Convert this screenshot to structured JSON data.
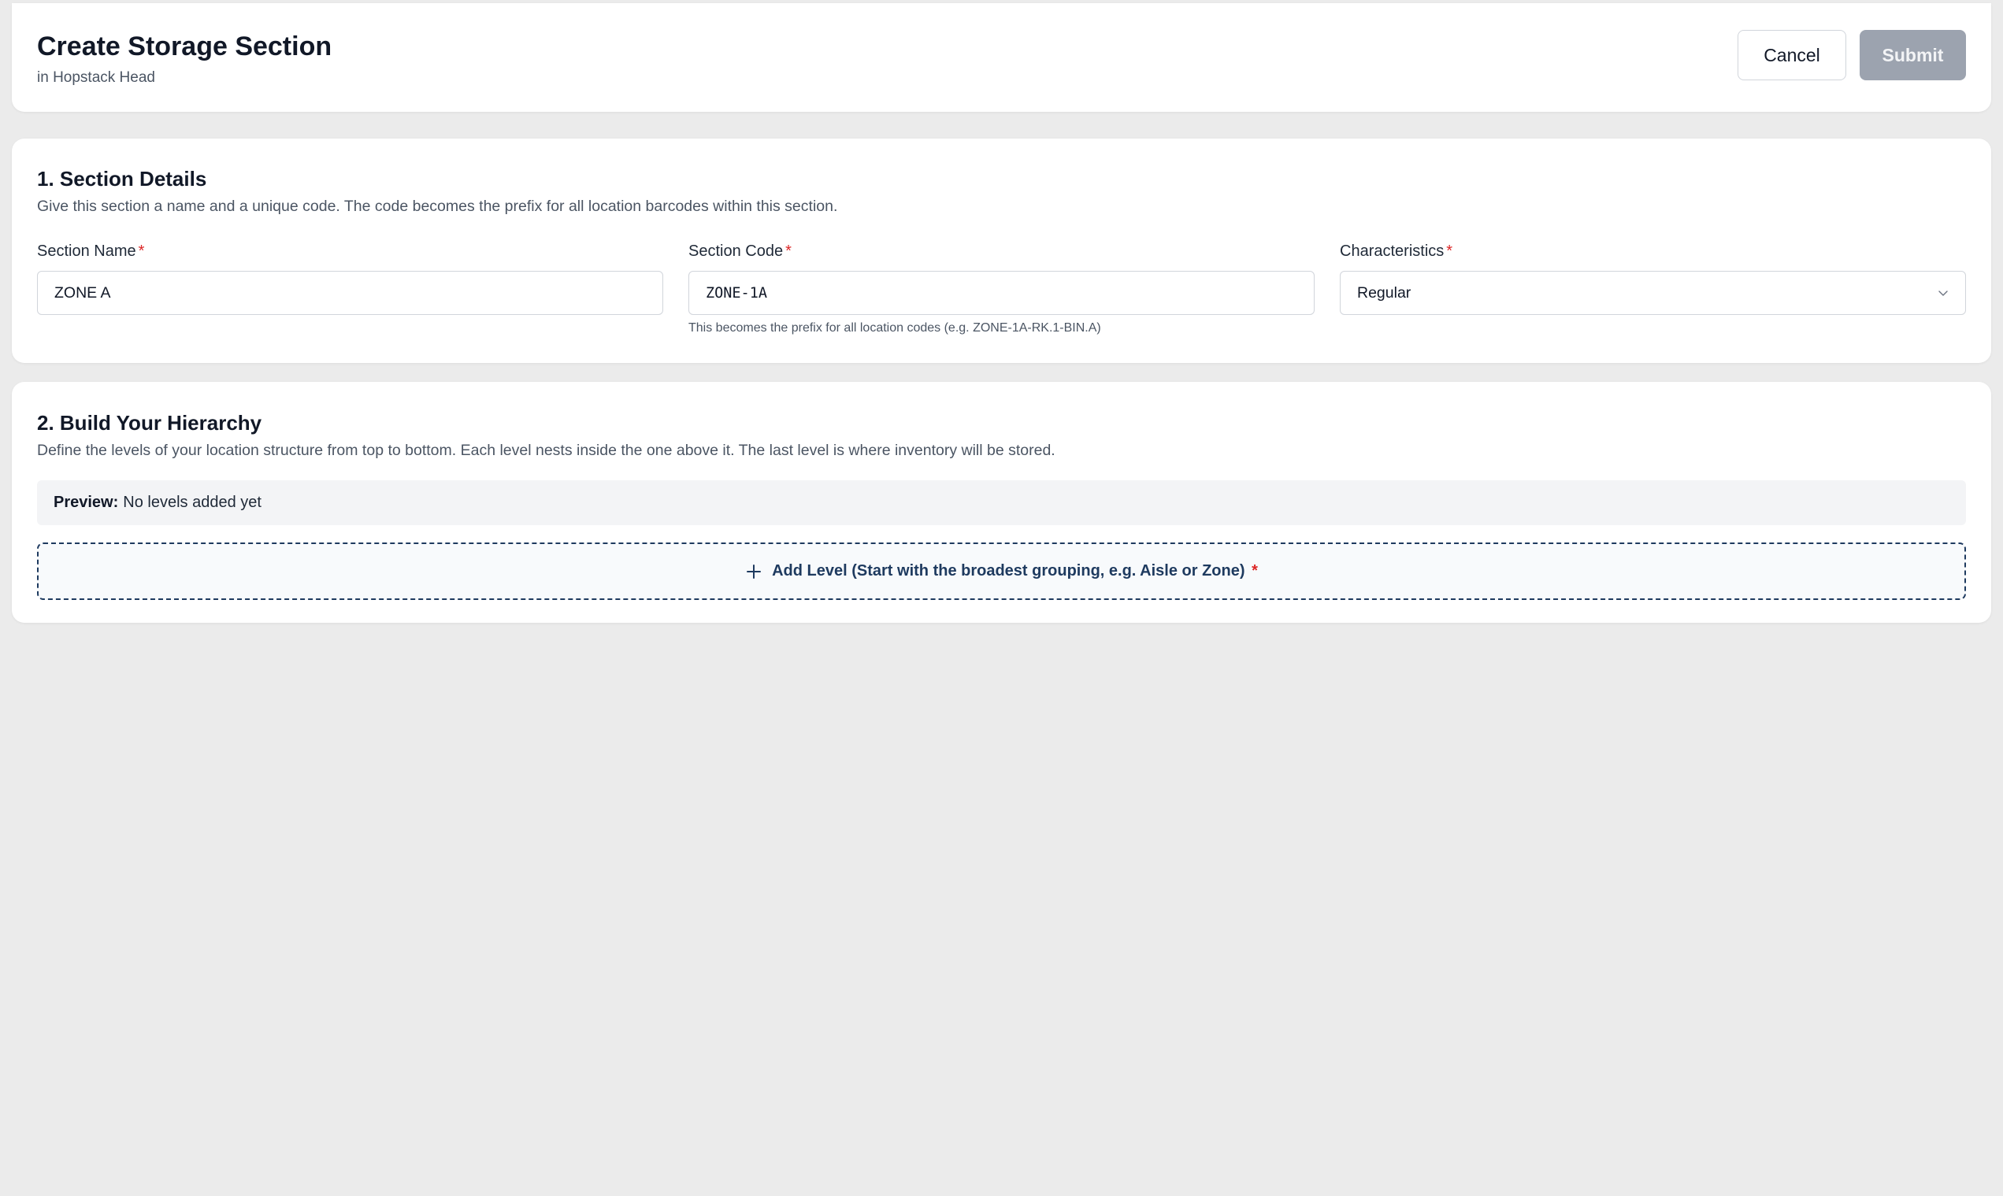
{
  "header": {
    "title": "Create Storage Section",
    "subtitle": "in Hopstack Head",
    "cancel_label": "Cancel",
    "submit_label": "Submit"
  },
  "section_details": {
    "title": "1. Section Details",
    "description": "Give this section a name and a unique code. The code becomes the prefix for all location barcodes within this section.",
    "fields": {
      "section_name": {
        "label": "Section Name",
        "required_mark": "*",
        "value": "ZONE A"
      },
      "section_code": {
        "label": "Section Code",
        "required_mark": "*",
        "value": "ZONE-1A",
        "hint": "This becomes the prefix for all location codes (e.g. ZONE-1A-RK.1-BIN.A)"
      },
      "characteristics": {
        "label": "Characteristics",
        "required_mark": "*",
        "selected": "Regular"
      }
    }
  },
  "hierarchy": {
    "title": "2. Build Your Hierarchy",
    "description": "Define the levels of your location structure from top to bottom. Each level nests inside the one above it. The last level is where inventory will be stored.",
    "preview_label": "Preview:",
    "preview_value": "No levels added yet",
    "add_level_label": "Add Level (Start with the broadest grouping, e.g. Aisle or Zone)",
    "add_level_required_mark": "*"
  },
  "icons": {
    "chevron": "chevron-down-icon",
    "plus": "plus-icon"
  },
  "colors": {
    "background": "#ebebeb",
    "card": "#ffffff",
    "required": "#dc2626",
    "submit_disabled": "#9ca3af",
    "accent_navy": "#1e3a5f"
  }
}
